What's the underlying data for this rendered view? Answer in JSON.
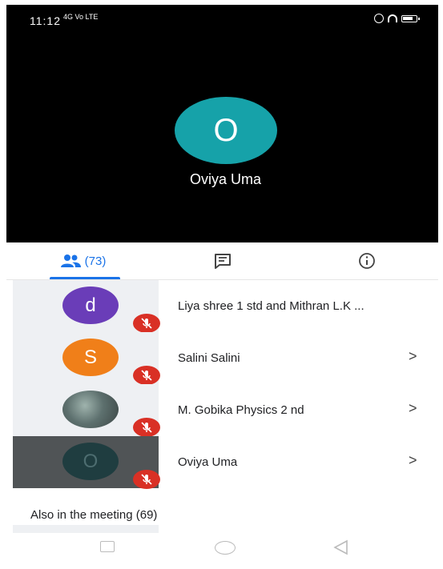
{
  "status_bar": {
    "time": "11:12",
    "network": "4G Vo LTE"
  },
  "main": {
    "avatar_letter": "O",
    "avatar_color": "#16a2a9",
    "name": "Oviya Uma"
  },
  "tabs": {
    "people_count": "(73)"
  },
  "participants": [
    {
      "letter": "d",
      "color": "#6a3db8",
      "name": "Liya shree 1 std and Mithran L.K ...",
      "chevron": "",
      "muted": true
    },
    {
      "letter": "S",
      "color": "#f07f19",
      "name": "Salini Salini",
      "chevron": ">",
      "muted": true
    },
    {
      "letter": "",
      "color": "#6b7c7a",
      "name": "M. Gobika Physics 2 nd",
      "chevron": ">",
      "muted": true,
      "photo": true
    },
    {
      "letter": "O",
      "color": "#1f3d40",
      "name": "Oviya Uma",
      "chevron": ">",
      "muted": true,
      "self": true
    }
  ],
  "also_in_meeting": "Also in the meeting (69)",
  "icons": [
    "people-icon",
    "chat-icon",
    "info-icon",
    "mic-off-icon",
    "chevron-right-icon",
    "nav-recents-icon",
    "nav-home-icon",
    "nav-back-icon"
  ],
  "colors": {
    "accent": "#1a73e8",
    "mute": "#d93025"
  }
}
